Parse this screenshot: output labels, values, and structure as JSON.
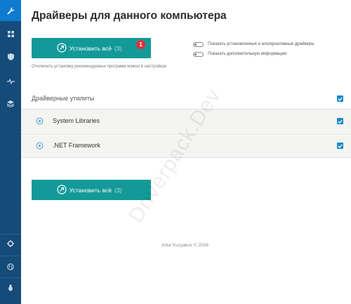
{
  "sidebar": {
    "items": [
      {
        "icon": "wrench-icon"
      },
      {
        "icon": "grid-icon"
      },
      {
        "icon": "shield-icon"
      },
      {
        "icon": "pulse-icon"
      },
      {
        "icon": "stack-icon"
      },
      {
        "icon": "gear-icon"
      },
      {
        "icon": "globe-icon"
      },
      {
        "icon": "bug-icon"
      }
    ]
  },
  "header": {
    "title": "Драйверы для данного компьютера"
  },
  "install": {
    "label": "Установить всё",
    "count": "(3)",
    "badge": "1"
  },
  "note": "Отключить установку рекомендуемых программ можно в настройках",
  "options": [
    {
      "label": "Показать установленные и альтернативные драйверы",
      "enabled": false
    },
    {
      "label": "Показать дополнительную информацию",
      "enabled": false
    }
  ],
  "section": {
    "label": "Драйверные утилиты",
    "checked": true
  },
  "drivers": [
    {
      "name": "System Libraries",
      "checked": true
    },
    {
      "name": ".NET Framework",
      "checked": true
    }
  ],
  "footer": "Artur Kuzyakov © 2026",
  "watermark": "Driverpack.Dev",
  "colors": {
    "sidebar": "#144b78",
    "sidebar_active": "#0e7bd0",
    "accent": "#139a98",
    "badge": "#e0303c",
    "checkbox": "#1a88c9"
  }
}
